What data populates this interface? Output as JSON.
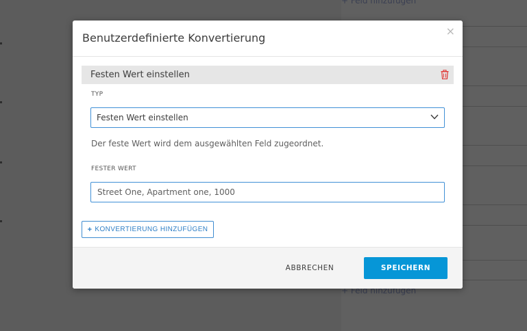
{
  "background": {
    "add_field_top": "+ Feld hinzufügen",
    "add_field_bottom": "+ Feld hinzufügen"
  },
  "dialog": {
    "title": "Benutzerdefinierte Konvertierung",
    "close_glyph": "×",
    "section_label": "Festen Wert einstellen",
    "type_label": "TYP",
    "type_selected": "Festen Wert einstellen",
    "help_text": "Der feste Wert wird dem ausgewählten Feld zugeordnet.",
    "fixed_value_label": "FESTER WERT",
    "fixed_value": "Street One, Apartment one, 1000",
    "add_conversion_plus": "+",
    "add_conversion_label": "KONVERTIERUNG HINZUFÜGEN",
    "cancel_label": "ABBRECHEN",
    "save_label": "SPEICHERN"
  },
  "icons": {
    "delete": "trash-icon",
    "dropdown": "chevron-down-icon",
    "close": "close-icon",
    "add": "plus-icon"
  },
  "colors": {
    "accent": "#0696d7",
    "danger": "#e0312f",
    "focus_border": "#3f8fd6"
  }
}
